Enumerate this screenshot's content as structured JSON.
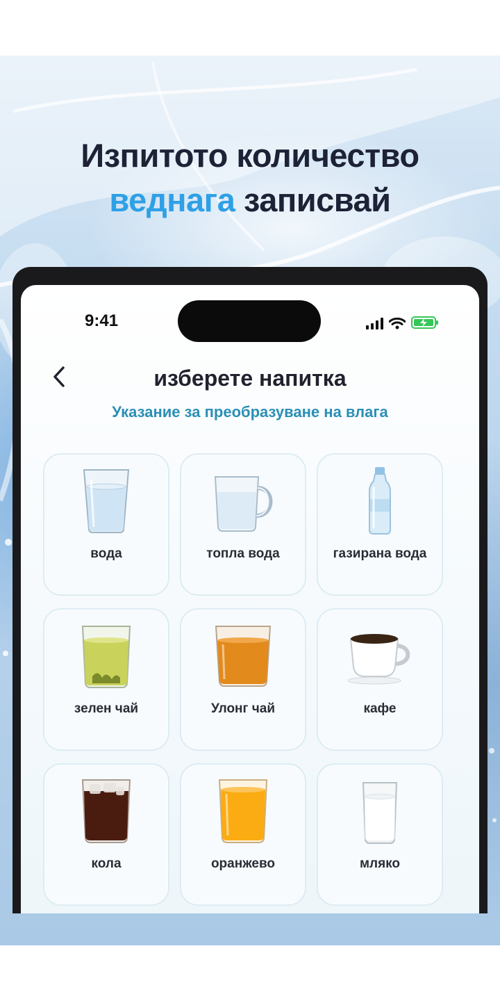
{
  "promo": {
    "headline_line1": "Изпитото количество",
    "headline_accent": "веднага",
    "headline_rest": " записвай",
    "accent_color": "#2ea0e6"
  },
  "status_bar": {
    "time": "9:41",
    "battery_color": "#35c759"
  },
  "header": {
    "back_icon": "chevron-left-icon",
    "title": "изберете напитка",
    "hint": "Указание за преобразуване на влага",
    "hint_color": "#2b8fb5"
  },
  "drinks": [
    {
      "label": "вода",
      "icon": "water-glass-icon"
    },
    {
      "label": "топла вода",
      "icon": "hot-water-mug-icon"
    },
    {
      "label": "газирана вода",
      "icon": "sparkling-water-bottle-icon"
    },
    {
      "label": "зелен чай",
      "icon": "green-tea-glass-icon"
    },
    {
      "label": "Улонг чай",
      "icon": "oolong-tea-glass-icon"
    },
    {
      "label": "кафе",
      "icon": "coffee-cup-icon"
    },
    {
      "label": "кола",
      "icon": "cola-glass-icon"
    },
    {
      "label": "оранжево",
      "icon": "orange-juice-glass-icon"
    },
    {
      "label": "мляко",
      "icon": "milk-glass-icon"
    }
  ]
}
